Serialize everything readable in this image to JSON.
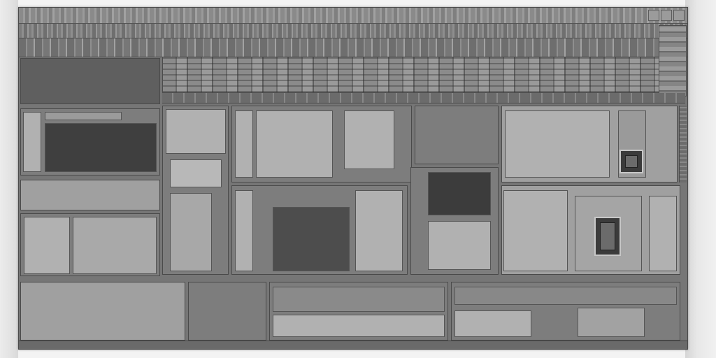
{
  "window": {
    "title": ""
  }
}
